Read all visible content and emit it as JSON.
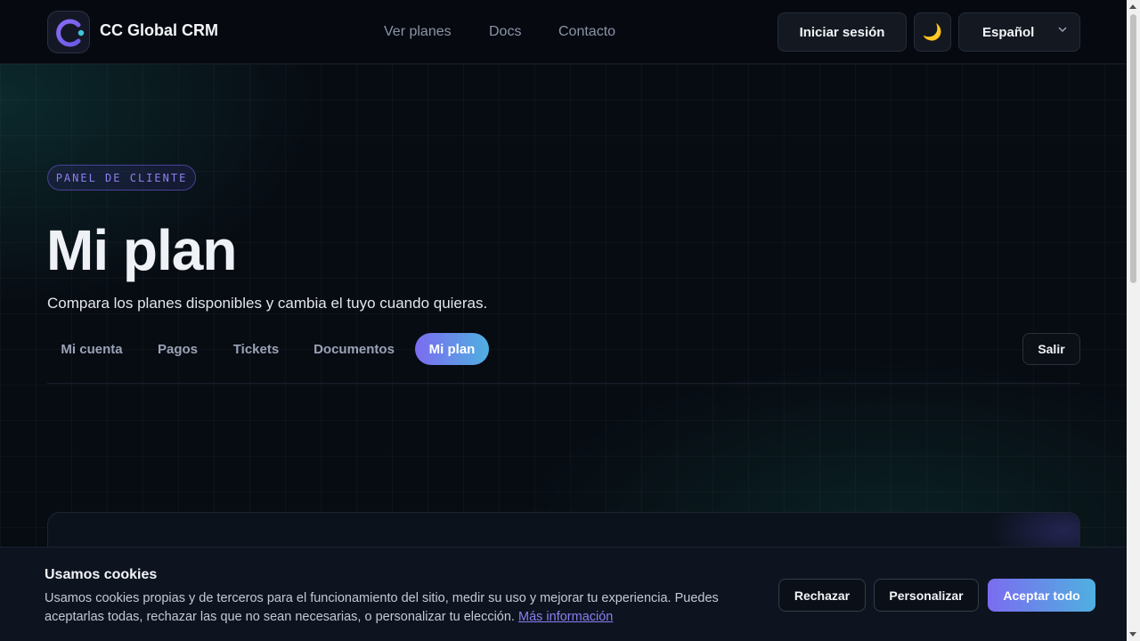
{
  "header": {
    "brand": "CC Global CRM",
    "nav": [
      "Ver planes",
      "Docs",
      "Contacto"
    ],
    "login_label": "Iniciar sesión",
    "theme_icon": "🌙",
    "language": "Español"
  },
  "hero": {
    "badge": "PANEL DE CLIENTE",
    "title": "Mi plan",
    "subtitle": "Compara los planes disponibles y cambia el tuyo cuando quieras."
  },
  "tabs": [
    {
      "label": "Mi cuenta",
      "active": false
    },
    {
      "label": "Pagos",
      "active": false
    },
    {
      "label": "Tickets",
      "active": false
    },
    {
      "label": "Documentos",
      "active": false
    },
    {
      "label": "Mi plan",
      "active": true
    }
  ],
  "exit_label": "Salir",
  "cookies": {
    "title": "Usamos cookies",
    "text": "Usamos cookies propias y de terceros para el funcionamiento del sitio, medir su uso y mejorar tu experiencia. Puedes aceptarlas todas, rechazar las que no sean necesarias, o personalizar tu elección.",
    "link": "Más información",
    "reject_label": "Rechazar",
    "customize_label": "Personalizar",
    "accept_label": "Aceptar todo"
  },
  "colors": {
    "accent_start": "#7b6cf0",
    "accent_end": "#4fb0e0",
    "background": "#070b12"
  }
}
